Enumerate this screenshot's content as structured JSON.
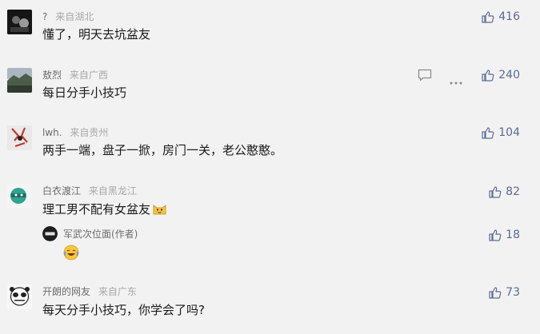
{
  "comments": [
    {
      "nickname": "?",
      "location": "来自湖北",
      "text": "懂了，明天去坑盆友",
      "likes": "416"
    },
    {
      "nickname": "敖烈",
      "location": "来自广西",
      "text": "每日分手小技巧",
      "likes": "240"
    },
    {
      "nickname": "lwh.",
      "location": "来自贵州",
      "text": "两手一端，盘子一掀，房门一关，老公憨憨。",
      "likes": "104"
    },
    {
      "nickname": "白衣渡江",
      "location": "来自黑龙江",
      "text": "理工男不配有女盆友",
      "likes": "82",
      "reply": {
        "nickname": "军武次位面(作者)",
        "likes": "18"
      }
    },
    {
      "nickname": "开朗的网友",
      "location": "来自广东",
      "text": "每天分手小技巧，你学会了吗?",
      "likes": "73"
    }
  ],
  "icons": {
    "like": "thumbs-up-icon",
    "comment": "comment-icon",
    "more": "more-icon",
    "accent": "#576b95"
  }
}
